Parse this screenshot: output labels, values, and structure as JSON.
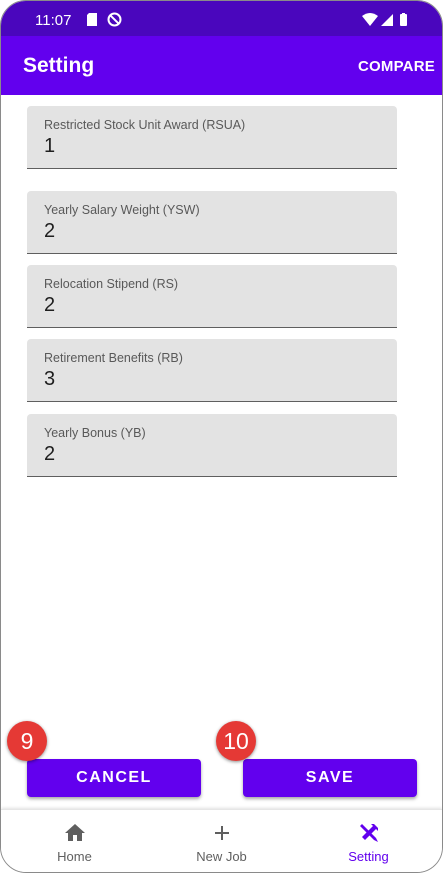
{
  "status_bar": {
    "time": "11:07"
  },
  "app_bar": {
    "title": "Setting",
    "compare_label": "COMPARE"
  },
  "fields": [
    {
      "label": "Restricted Stock Unit Award (RSUA)",
      "value": "1"
    },
    {
      "label": "Yearly Salary Weight (YSW)",
      "value": "2"
    },
    {
      "label": "Relocation Stipend (RS)",
      "value": "2"
    },
    {
      "label": "Retirement Benefits (RB)",
      "value": "3"
    },
    {
      "label": "Yearly Bonus (YB)",
      "value": "2"
    }
  ],
  "actions": {
    "cancel_label": "CANCEL",
    "save_label": "SAVE"
  },
  "annotations": {
    "cancel_badge": "9",
    "save_badge": "10"
  },
  "bottom_nav": {
    "items": [
      {
        "label": "Home",
        "icon": "home-icon",
        "active": false
      },
      {
        "label": "New Job",
        "icon": "plus-icon",
        "active": false
      },
      {
        "label": "Setting",
        "icon": "tools-icon",
        "active": true
      }
    ]
  },
  "colors": {
    "primary": "#6200ee",
    "primary_dark": "#4a06bd",
    "badge": "#e53935",
    "nav_inactive": "#5f5f5f"
  }
}
